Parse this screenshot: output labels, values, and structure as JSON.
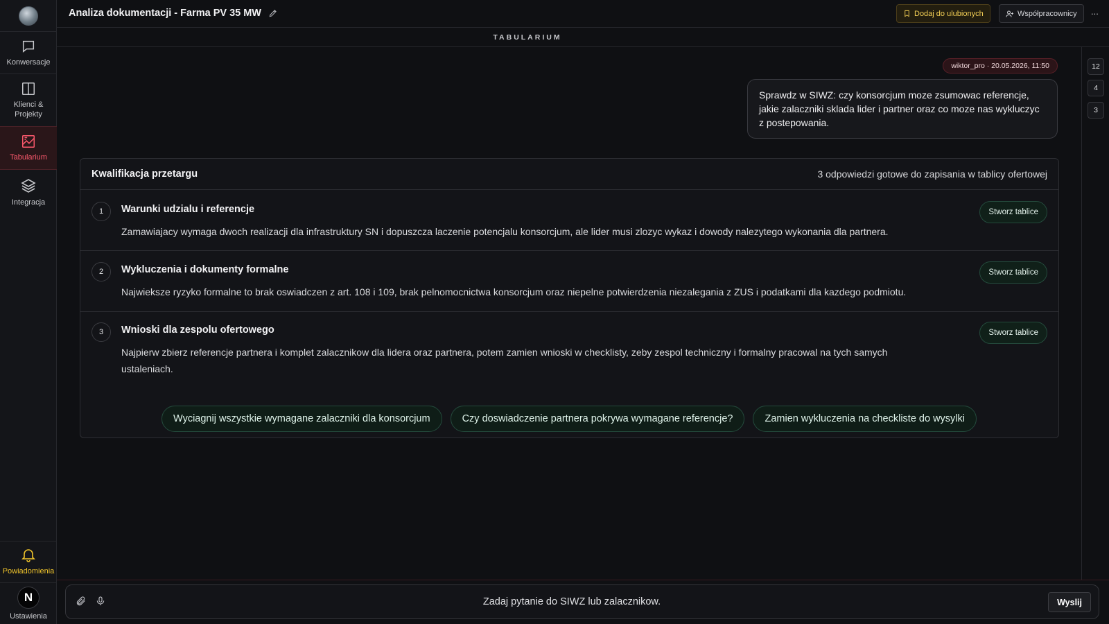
{
  "app": {
    "section": "TABULARIUM"
  },
  "sidebar": {
    "items": [
      {
        "label": "Konwersacje",
        "icon": "chat-icon"
      },
      {
        "label": "Klienci & Projekty",
        "icon": "columns-icon"
      },
      {
        "label": "Tabularium",
        "icon": "tabularium-icon"
      },
      {
        "label": "Integracja",
        "icon": "layers-icon"
      }
    ],
    "notifications_label": "Powiadomienia",
    "settings_label": "Ustawienia",
    "avatar_initial": "N"
  },
  "header": {
    "title": "Analiza dokumentacji - Farma PV 35 MW",
    "favorite_label": "Dodaj do ulubionych",
    "collaborators_label": "Współpracownicy",
    "more_label": "..."
  },
  "rail": {
    "badges": [
      "12",
      "4",
      "3"
    ]
  },
  "conversation": {
    "user_meta": "wiktor_pro · 20.05.2026, 11:50",
    "user_message": "Sprawdz w SIWZ: czy konsorcjum moze zsumowac referencje, jakie zalaczniki sklada lider i partner oraz co moze nas wykluczyc z postepowania."
  },
  "card": {
    "title": "Kwalifikacja przetargu",
    "status": "3 odpowiedzi gotowe do zapisania w tablicy ofertowej",
    "rows": [
      {
        "num": "1",
        "title": "Warunki udzialu i referencje",
        "text": "Zamawiajacy wymaga dwoch realizacji dla infrastruktury SN i dopuszcza laczenie potencjalu konsorcjum, ale lider musi zlozyc wykaz i dowody nalezytego wykonania dla partnera.",
        "button": "Stworz tablice"
      },
      {
        "num": "2",
        "title": "Wykluczenia i dokumenty formalne",
        "text": "Najwieksze ryzyko formalne to brak oswiadczen z art. 108 i 109, brak pelnomocnictwa konsorcjum oraz niepelne potwierdzenia niezalegania z ZUS i podatkami dla kazdego podmiotu.",
        "button": "Stworz tablice"
      },
      {
        "num": "3",
        "title": "Wnioski dla zespolu ofertowego",
        "text": "Najpierw zbierz referencje partnera i komplet zalacznikow dla lidera oraz partnera, potem zamien wnioski w checklisty, zeby zespol techniczny i formalny pracowal na tych samych ustaleniach.",
        "button": "Stworz tablice"
      }
    ]
  },
  "suggestions": [
    "Wyciagnij wszystkie wymagane zalaczniki dla konsorcjum",
    "Czy doswiadczenie partnera pokrywa wymagane referencje?",
    "Zamien wykluczenia na checkliste do wysylki"
  ],
  "composer": {
    "placeholder": "Zadaj pytanie do SIWZ lub zalacznikow.",
    "send_label": "Wyslij"
  },
  "colors": {
    "accent": "#ff5a6e",
    "notification": "#f0c42b",
    "favorite": "#f3cf55",
    "green_border": "#244a3c"
  }
}
